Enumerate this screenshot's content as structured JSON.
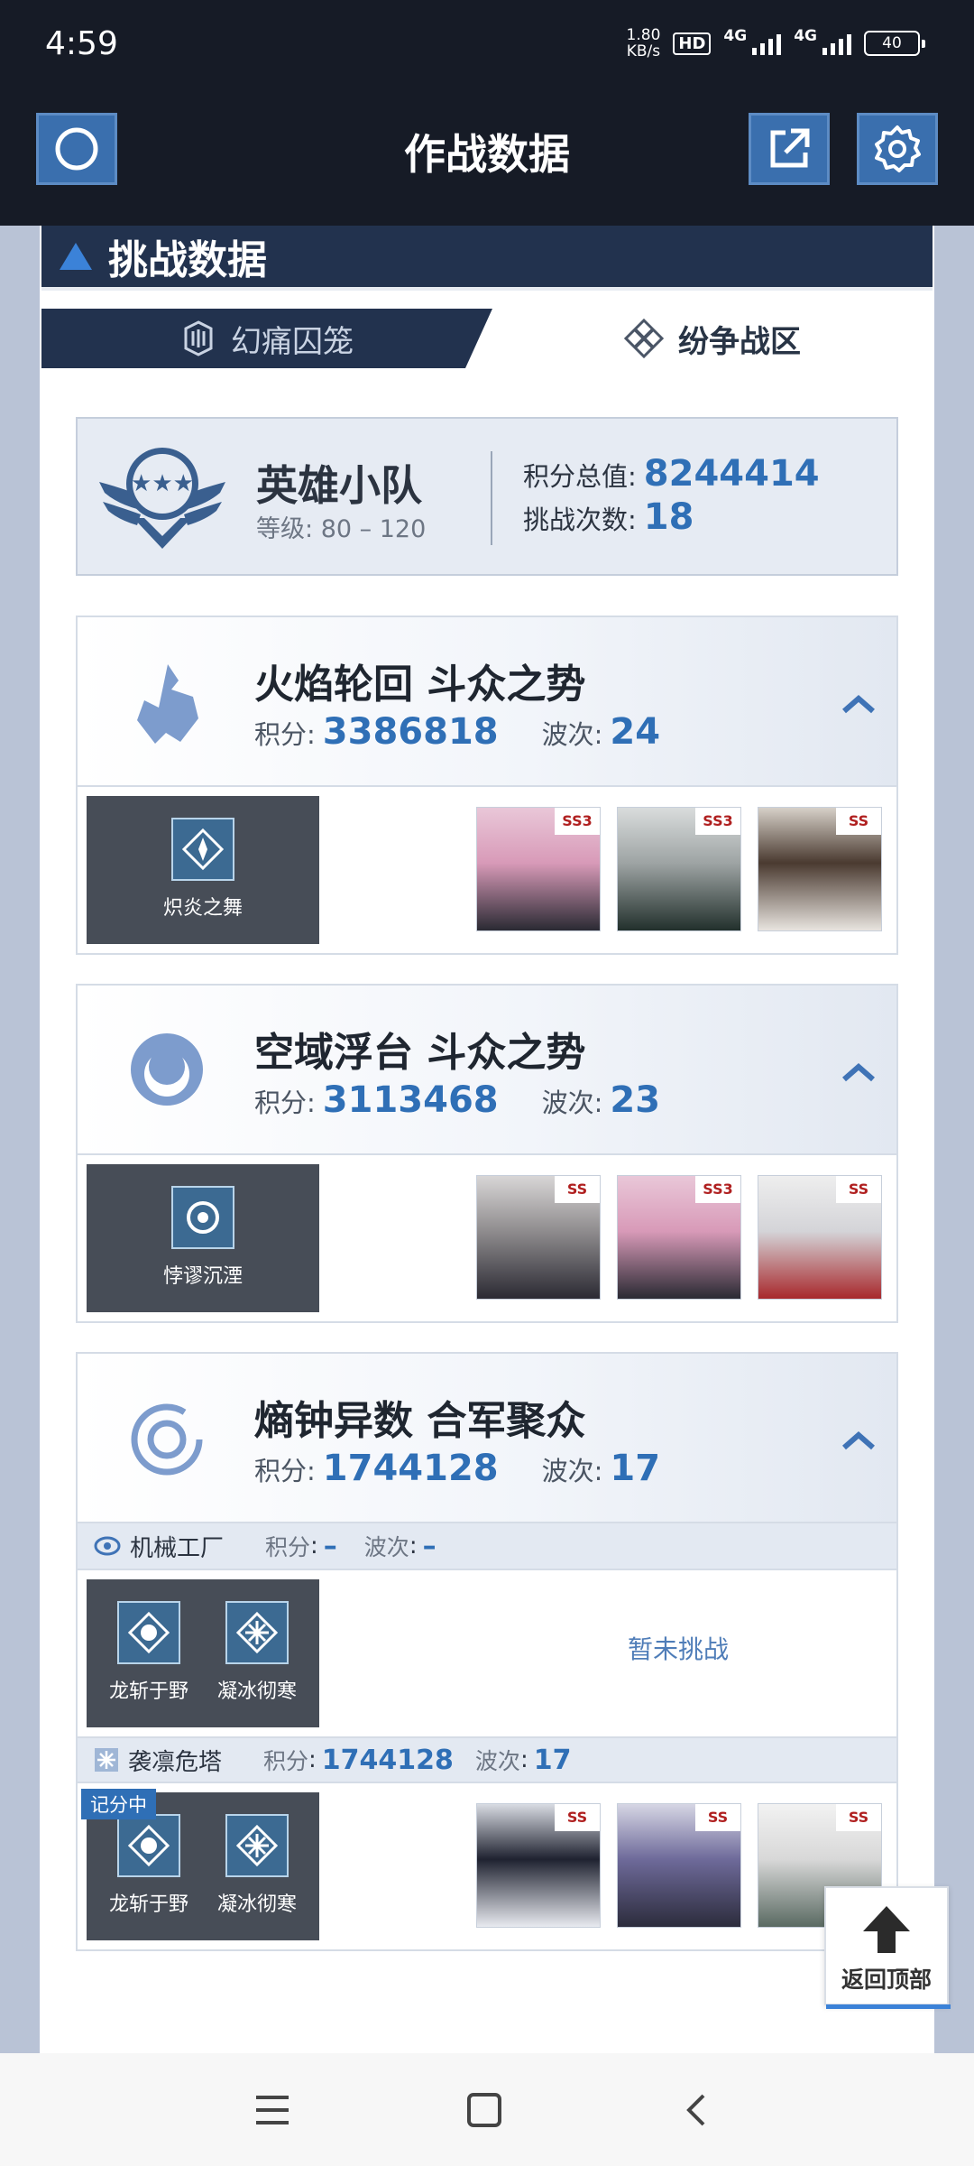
{
  "status_bar": {
    "time": "4:59",
    "speed_value": "1.80",
    "speed_unit": "KB/s",
    "hd": "HD",
    "network_1": "4G",
    "network_2": "4G",
    "battery": "40"
  },
  "header": {
    "title": "作战数据",
    "left_icon": "circle-icon",
    "share_icon": "external-link-icon",
    "settings_icon": "gear-icon"
  },
  "section": {
    "title": "挑战数据"
  },
  "tabs": [
    {
      "label": "幻痛囚笼",
      "active": false
    },
    {
      "label": "纷争战区",
      "active": true
    }
  ],
  "summary": {
    "team_name": "英雄小队",
    "level_label": "等级",
    "level_value": "80 – 120",
    "total_score_label": "积分总值",
    "total_score": "8244414",
    "attempts_label": "挑战次数",
    "attempts": "18"
  },
  "labels": {
    "score": "积分",
    "wave": "波次",
    "separator": ":"
  },
  "stages": [
    {
      "title": "火焰轮回 斗众之势",
      "score": "3386818",
      "wave": "24",
      "skills": [
        "炽炎之舞"
      ],
      "characters": [
        {
          "rank": "SS3",
          "name": "pink-hair-character"
        },
        {
          "rank": "SS3",
          "name": "grey-hair-character"
        },
        {
          "rank": "SS",
          "name": "dark-hair-character"
        }
      ]
    },
    {
      "title": "空域浮台 斗众之势",
      "score": "3113468",
      "wave": "23",
      "skills": [
        "悖谬沉湮"
      ],
      "characters": [
        {
          "rank": "SS",
          "name": "silver-hair-character"
        },
        {
          "rank": "SS3",
          "name": "pink-hair-character"
        },
        {
          "rank": "SS",
          "name": "white-hair-character"
        }
      ]
    },
    {
      "title": "熵钟异数 合军聚众",
      "score": "1744128",
      "wave": "17",
      "sub_stages": [
        {
          "name": "机械工厂",
          "score": "–",
          "wave": "–",
          "skills": [
            "龙斩于野",
            "凝冰彻寒"
          ],
          "status": "暂未挑战"
        },
        {
          "name": "袭凛危塔",
          "score": "1744128",
          "wave": "17",
          "badge": "记分中",
          "skills": [
            "龙斩于野",
            "凝冰彻寒"
          ],
          "characters": [
            {
              "rank": "SS",
              "name": "black-hair-character"
            },
            {
              "rank": "SS",
              "name": "purple-hair-character"
            },
            {
              "rank": "SS",
              "name": "white-hair-character"
            }
          ]
        }
      ]
    }
  ],
  "back_to_top": "返回顶部",
  "colors": {
    "accent": "#2f6fb6",
    "header_bg": "#161b26",
    "panel_bar": "#22324e"
  }
}
